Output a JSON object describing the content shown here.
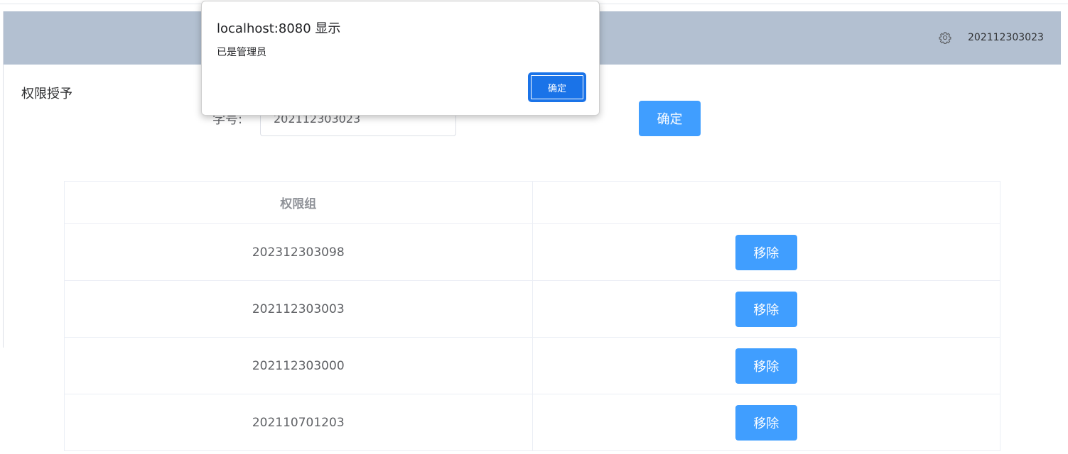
{
  "header": {
    "username": "202112303023",
    "icons": {
      "settings": "gear-icon"
    },
    "background_color": "#b3c0d1"
  },
  "section": {
    "title": "权限授予"
  },
  "form": {
    "student_id_label": "学号:",
    "student_id_value": "202112303023",
    "confirm_label": "确定"
  },
  "table": {
    "columns": [
      "权限组",
      ""
    ],
    "rows": [
      {
        "id": "202312303098",
        "action": "移除"
      },
      {
        "id": "202112303003",
        "action": "移除"
      },
      {
        "id": "202112303000",
        "action": "移除"
      },
      {
        "id": "202110701203",
        "action": "移除"
      }
    ]
  },
  "dialog": {
    "title": "localhost:8080 显示",
    "message": "已是管理员",
    "ok_label": "确定"
  },
  "colors": {
    "primary": "#409eff",
    "dialog_button": "#1a73e8"
  }
}
